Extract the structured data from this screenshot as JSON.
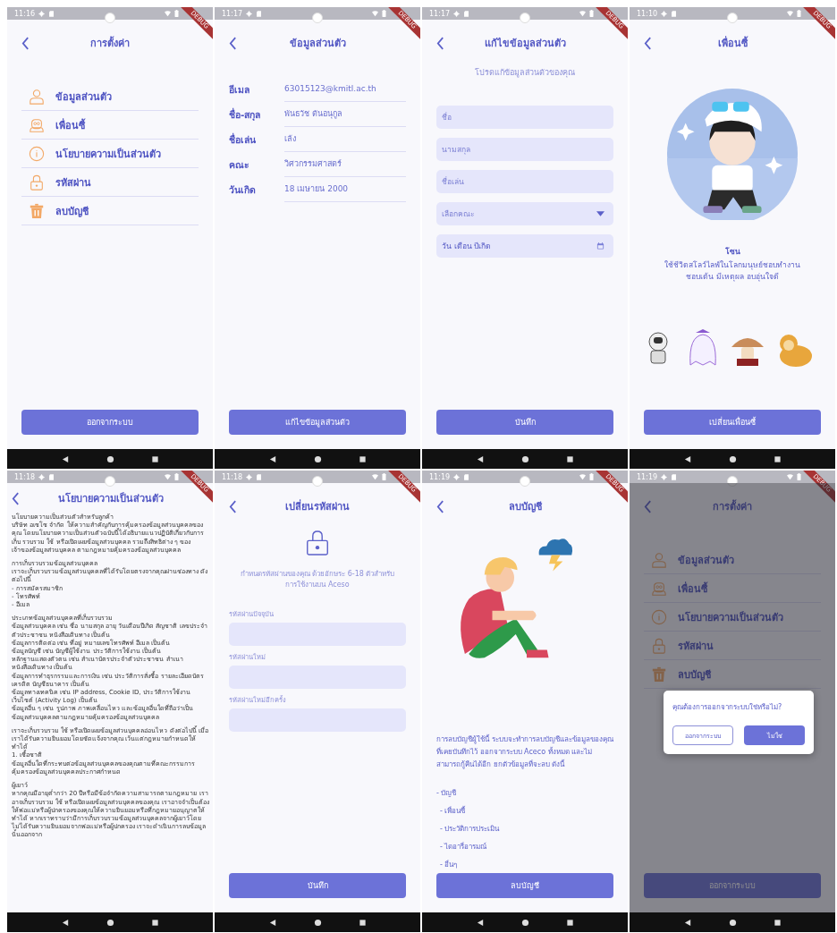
{
  "screens": [
    {
      "kind": "settings",
      "status_time": "11:16",
      "debug_banner": "DEBUG",
      "title": "การตั้งค่า",
      "menu": [
        {
          "kind": "profile",
          "label": "ข้อมูลส่วนตัว"
        },
        {
          "kind": "buddy",
          "label": "เพื่อนซี้"
        },
        {
          "kind": "privacy",
          "label": "นโยบายความเป็นส่วนตัว"
        },
        {
          "kind": "password",
          "label": "รหัสผ่าน"
        },
        {
          "kind": "delete",
          "label": "ลบบัญชี"
        }
      ],
      "button": "ออกจากระบบ"
    },
    {
      "kind": "profile",
      "status_time": "11:17",
      "debug_banner": "DEBUG",
      "title": "ข้อมูลส่วนตัว",
      "rows": [
        {
          "label": "อีเมล",
          "value": "63015123@kmitl.ac.th"
        },
        {
          "label": "ชื่อ-สกุล",
          "value": "พันธวัช ตันอนุกูล"
        },
        {
          "label": "ชื่อเล่น",
          "value": "เล้ง"
        },
        {
          "label": "คณะ",
          "value": "วิศวกรรมศาสตร์"
        },
        {
          "label": "วันเกิด",
          "value": "18 เมษายน 2000"
        }
      ],
      "button": "แก้ไขข้อมูลส่วนตัว"
    },
    {
      "kind": "edit",
      "status_time": "11:17",
      "debug_banner": "DEBUG",
      "title": "แก้ไขข้อมูลส่วนตัว",
      "subtitle": "โปรดแก้ข้อมูลส่วนตัวของคุณ",
      "fields": [
        {
          "kind": "text",
          "placeholder": "ชื่อ"
        },
        {
          "kind": "text",
          "placeholder": "นามสกุล"
        },
        {
          "kind": "text",
          "placeholder": "ชื่อเล่น"
        },
        {
          "kind": "dropdown",
          "placeholder": "เลือกคณะ"
        },
        {
          "kind": "date",
          "placeholder": "วัน เดือน ปีเกิด"
        }
      ],
      "button": "บันทึก"
    },
    {
      "kind": "buddy",
      "status_time": "11:10",
      "debug_banner": "DEBUG",
      "title": "เพื่อนซี้",
      "buddy_name": "โซน",
      "description": [
        "ใช้ชีวิตสโลว์ไลฟ์ในโลกมนุษย์ชอบทำงาน",
        "ชอบเต้น มีเหตุผล อบอุ่นใจดี"
      ],
      "choices": [
        {
          "kind": "picture"
        },
        {
          "kind": "picture"
        },
        {
          "kind": "picture"
        },
        {
          "kind": "picture"
        }
      ],
      "button": "เปลี่ยนเพื่อนซี้"
    },
    {
      "kind": "privacy",
      "status_time": "11:18",
      "debug_banner": "DEBUG",
      "title": "นโยบายความเป็นส่วนตัว",
      "paragraphs": [
        "นโยบายความเป็นส่วนตัวสำหรับลูกค้า\nบริษัท อเซโซ จำกัด ให้ความสำคัญกับการคุ้มครองข้อมูลส่วนบุคคลของคุณ โดยนโยบายความเป็นส่วนตัวฉบับนี้ได้อธิบายแนวปฏิบัติเกี่ยวกับการเก็บ รวบรวม ใช้ หรือเปิดเผยข้อมูลส่วนบุคคล รวมถึงสิทธิต่าง ๆ ของเจ้าของข้อมูลส่วนบุคคล ตามกฎหมายคุ้มครองข้อมูลส่วนบุคคล",
        "การเก็บรวบรวมข้อมูลส่วนบุคคล\nเราจะเก็บรวบรวมข้อมูลส่วนบุคคลที่ได้รับโดยตรงจากคุณผ่านช่องทาง ดังต่อไปนี้\n- การสมัครสมาชิก\n- โทรศัพท์\n- อีเมล",
        "ประเภทข้อมูลส่วนบุคคลที่เก็บรวบรวม\nข้อมูลส่วนบุคคล เช่น ชื่อ นามสกุล อายุ วันเดือนปีเกิด สัญชาติ เลขประจำตัวประชาชน หนังสือเดินทาง เป็นต้น\nข้อมูลการติดต่อ เช่น ที่อยู่ หมายเลขโทรศัพท์ อีเมล เป็นต้น\nข้อมูลบัญชี เช่น บัญชีผู้ใช้งาน ประวัติการใช้งาน เป็นต้น\nหลักฐานแสดงตัวตน เช่น สำเนาบัตรประจำตัวประชาชน สำเนาหนังสือเดินทาง เป็นต้น\nข้อมูลการทำธุรกรรมและการเงิน เช่น ประวัติการสั่งซื้อ รายละเอียดบัตรเครดิต บัญชีธนาคาร เป็นต้น\nข้อมูลทางเทคนิค เช่น IP address, Cookie ID, ประวัติการใช้งานเว็บไซต์ (Activity Log) เป็นต้น\nข้อมูลอื่น ๆ เช่น รูปภาพ ภาพเคลื่อนไหว และข้อมูลอื่นใดที่ถือว่าเป็นข้อมูลส่วนบุคคลตามกฎหมายคุ้มครองข้อมูลส่วนบุคคล",
        "เราจะเก็บรวบรวม ใช้ หรือเปิดเผยข้อมูลส่วนบุคคลอ่อนไหว ดังต่อไปนี้ เมื่อเราได้รับความยินยอมโดยชัดแจ้งจากคุณ เว้นแต่กฎหมายกำหนดให้ทำได้\n1. เชื้อชาติ\nข้อมูลอื่นใดที่กระทบต่อข้อมูลส่วนบุคคลของคุณตามที่คณะกรรมการคุ้มครองข้อมูลส่วนบุคคลประกาศกำหนด",
        "ผู้เยาว์\nหากคุณมีอายุต่ำกว่า 20 ปีหรือมีข้อจำกัดความสามารถตามกฎหมาย เราอาจเก็บรวบรวม ใช้ หรือเปิดเผยข้อมูลส่วนบุคคลของคุณ เราอาจจำเป็นต้องให้พ่อแม่หรือผู้ปกครองของคุณให้ความยินยอมหรือที่กฎหมายอนุญาตให้ทำได้ หากเราทราบว่ามีการเก็บรวบรวมข้อมูลส่วนบุคคลจากผู้เยาว์โดยไม่ได้รับความยินยอมจากพ่อแม่หรือผู้ปกครอง เราจะดำเนินการลบข้อมูลนั้นออกจาก"
      ]
    },
    {
      "kind": "password",
      "status_time": "11:18",
      "debug_banner": "DEBUG",
      "title": "เปลี่ยนรหัสผ่าน",
      "description": "กำหนดรหัสผ่านของคุณ ด้วยอักษระ 6-18 ตัวสำหรับการใช้งานบน Aceso",
      "fields": [
        {
          "label": "รหัสผ่านปัจจุบัน"
        },
        {
          "label": "รหัสผ่านใหม่"
        },
        {
          "label": "รหัสผ่านใหม่อีกครั้ง"
        }
      ],
      "button": "บันทึก"
    },
    {
      "kind": "delete",
      "status_time": "11:19",
      "debug_banner": "DEBUG",
      "title": "ลบบัญชี",
      "description": "การลบบัญชีผู้ใช้นี้ ระบบจะทำการลบบัญชีและข้อมูลของคุณที่เคยบันทึกไว้ ออกจากระบบ Aceco ทั้งหมด และไม่สามารถกู้คืนได้อีก ยกตัวข้อมูลที่จะลบ ดังนี้",
      "items": [
        {
          "text": "- บัญชี",
          "children": [
            {
              "text": "- เพื่อนซี้"
            },
            {
              "text": "- ประวัติการประเมิน"
            },
            {
              "text": "- ไดอารี่อารมณ์"
            },
            {
              "text": "- อื่นๆ"
            }
          ]
        }
      ],
      "button": "ลบบัญชี"
    },
    {
      "kind": "settings",
      "status_time": "11:19",
      "debug_banner": "DEBUG",
      "title": "การตั้งค่า",
      "menu": [
        {
          "kind": "profile",
          "label": "ข้อมูลส่วนตัว"
        },
        {
          "kind": "buddy",
          "label": "เพื่อนซี้"
        },
        {
          "kind": "privacy",
          "label": "นโยบายความเป็นส่วนตัว"
        },
        {
          "kind": "password",
          "label": "รหัสผ่าน"
        },
        {
          "kind": "delete",
          "label": "ลบบัญชี"
        }
      ],
      "button": "ออกจากระบบ",
      "dialog": {
        "message": "คุณต้องการออกจากระบบใช่หรือไม่?",
        "buttons": [
          {
            "kind": "outline",
            "label": "ออกจากระบบ"
          },
          {
            "kind": "filled",
            "label": "ไม่ใช่"
          }
        ]
      }
    }
  ]
}
